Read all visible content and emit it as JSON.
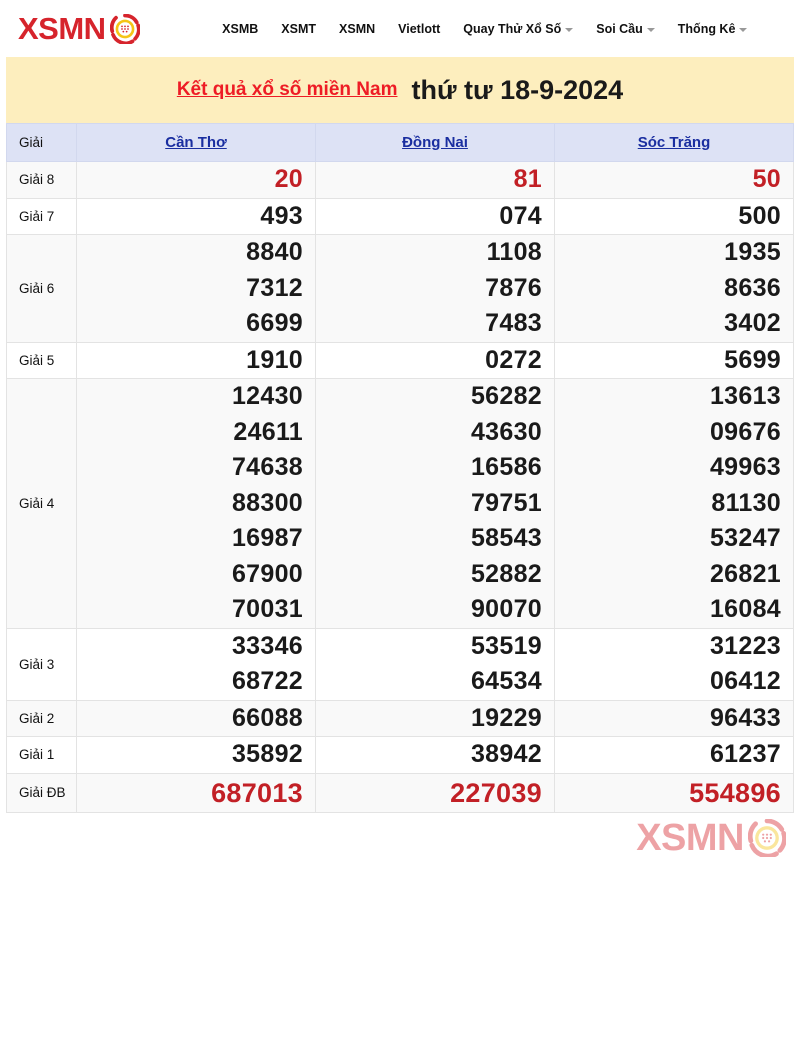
{
  "site": {
    "logo_text": "XSMN",
    "logo_icon": "lottery-ball-icon"
  },
  "nav": {
    "items": [
      {
        "label": "XSMB",
        "has_dropdown": false
      },
      {
        "label": "XSMT",
        "has_dropdown": false
      },
      {
        "label": "XSMN",
        "has_dropdown": false
      },
      {
        "label": "Vietlott",
        "has_dropdown": false
      },
      {
        "label": "Quay Thử Xổ Số",
        "has_dropdown": true
      },
      {
        "label": "Soi Cầu",
        "has_dropdown": true
      },
      {
        "label": "Thống Kê",
        "has_dropdown": true
      }
    ]
  },
  "banner": {
    "title": "Kết quả xổ số miền Nam",
    "date": "thứ tư 18-9-2024"
  },
  "table": {
    "label_header": "Giải",
    "provinces": [
      "Cần Thơ",
      "Đồng Nai",
      "Sóc Trăng"
    ],
    "rows": [
      {
        "label": "Giải 8",
        "style": "red",
        "values": [
          [
            "20"
          ],
          [
            "81"
          ],
          [
            "50"
          ]
        ]
      },
      {
        "label": "Giải 7",
        "style": "black",
        "values": [
          [
            "493"
          ],
          [
            "074"
          ],
          [
            "500"
          ]
        ]
      },
      {
        "label": "Giải 6",
        "style": "black",
        "values": [
          [
            "8840",
            "7312",
            "6699"
          ],
          [
            "1108",
            "7876",
            "7483"
          ],
          [
            "1935",
            "8636",
            "3402"
          ]
        ]
      },
      {
        "label": "Giải 5",
        "style": "black",
        "values": [
          [
            "1910"
          ],
          [
            "0272"
          ],
          [
            "5699"
          ]
        ]
      },
      {
        "label": "Giải 4",
        "style": "black",
        "values": [
          [
            "12430",
            "24611",
            "74638",
            "88300",
            "16987",
            "67900",
            "70031"
          ],
          [
            "56282",
            "43630",
            "16586",
            "79751",
            "58543",
            "52882",
            "90070"
          ],
          [
            "13613",
            "09676",
            "49963",
            "81130",
            "53247",
            "26821",
            "16084"
          ]
        ]
      },
      {
        "label": "Giải 3",
        "style": "black",
        "values": [
          [
            "33346",
            "68722"
          ],
          [
            "53519",
            "64534"
          ],
          [
            "31223",
            "06412"
          ]
        ]
      },
      {
        "label": "Giải 2",
        "style": "black",
        "values": [
          [
            "66088"
          ],
          [
            "19229"
          ],
          [
            "96433"
          ]
        ]
      },
      {
        "label": "Giải 1",
        "style": "black",
        "values": [
          [
            "35892"
          ],
          [
            "38942"
          ],
          [
            "61237"
          ]
        ]
      },
      {
        "label": "Giải ĐB",
        "style": "red-big",
        "values": [
          [
            "687013"
          ],
          [
            "227039"
          ],
          [
            "554896"
          ]
        ]
      }
    ]
  },
  "footer": {
    "watermark_text": "XSMN",
    "watermark_icon": "lottery-ball-icon"
  },
  "colors": {
    "brand_red": "#d6242c",
    "title_red": "#ee1c25",
    "number_red": "#c22026",
    "link_blue": "#1a2ea0",
    "banner_bg": "#fdeebe",
    "header_bg": "#dde2f5"
  }
}
